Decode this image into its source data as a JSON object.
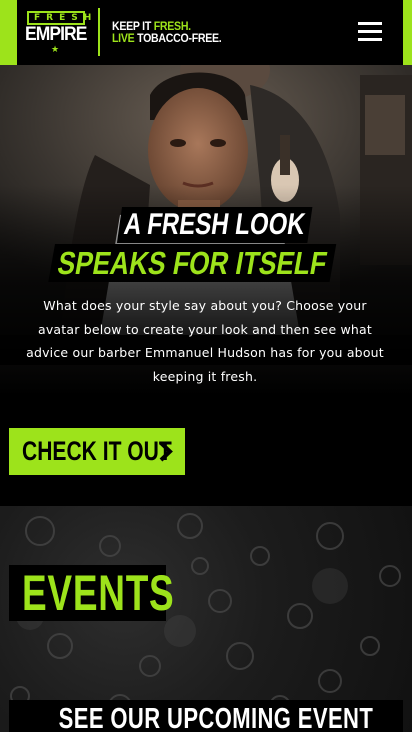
{
  "brand": {
    "logo_top": "FRESH",
    "logo_main": "EMPIRE",
    "logo_star": "★",
    "tagline_line1_a": "KEEP IT ",
    "tagline_line1_b": "FRESH.",
    "tagline_line2_a": "LIVE",
    "tagline_line2_b": " TOBACCO-FREE."
  },
  "header": {
    "menu_icon": "hamburger-menu-icon"
  },
  "hero": {
    "headline_line1": "A FRESH LOOK",
    "headline_line2": "SPEAKS FOR ITSELF",
    "body": "What does your style say about you? Choose your avatar below to create your look and then see what advice our barber Emmanuel Hudson has for you about keeping it fresh.",
    "cta_label": "CHECK IT OUT",
    "cta_icon": "chevron-right-icon"
  },
  "events": {
    "title": "EVENTS",
    "upcoming_label": "SEE OUR UPCOMING EVENT"
  },
  "colors": {
    "accent": "#9de31b",
    "background": "#000000",
    "text": "#ffffff"
  }
}
